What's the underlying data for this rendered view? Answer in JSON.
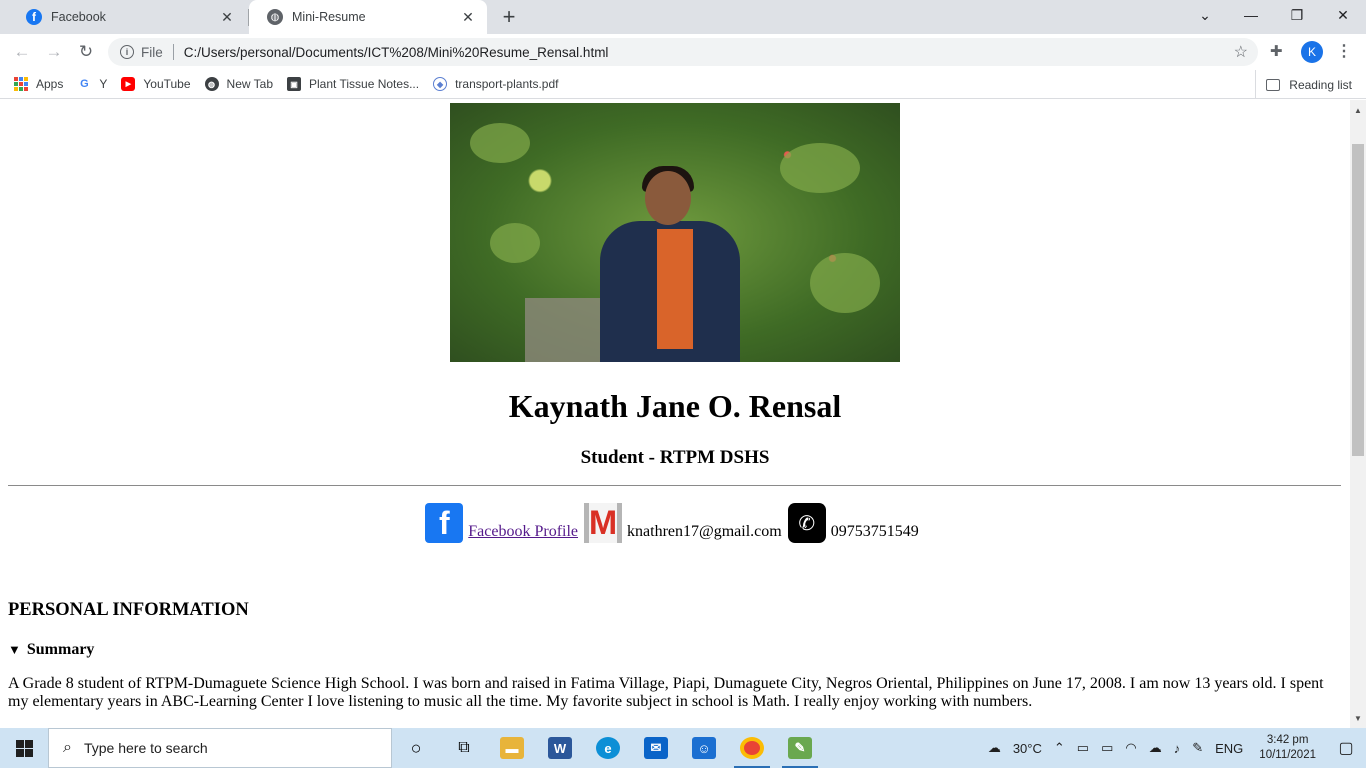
{
  "browser": {
    "tabs": [
      {
        "title": "Facebook",
        "icon": "facebook-icon",
        "active": false
      },
      {
        "title": "Mini-Resume",
        "icon": "globe-icon",
        "active": true
      }
    ],
    "address": {
      "scheme_label": "File",
      "url": "C:/Users/personal/Documents/ICT%208/Mini%20Resume_Rensal.html"
    },
    "profile_initial": "K",
    "bookmarks": [
      {
        "label": "Apps",
        "icon": "apps-grid-icon"
      },
      {
        "label": "Y",
        "icon": "google-icon"
      },
      {
        "label": "YouTube",
        "icon": "youtube-icon"
      },
      {
        "label": "New Tab",
        "icon": "new-tab-icon"
      },
      {
        "label": "Plant Tissue Notes...",
        "icon": "bookmark-page-icon"
      },
      {
        "label": "transport-plants.pdf",
        "icon": "pdf-icon"
      }
    ],
    "reading_list_label": "Reading list"
  },
  "resume": {
    "name": "Kaynath Jane O. Rensal",
    "role": "Student - RTPM DSHS",
    "contacts": {
      "facebook_label": "Facebook Profile",
      "email": "knathren17@gmail.com",
      "phone": "09753751549"
    },
    "section_title": "PERSONAL INFORMATION",
    "summary_label": "Summary",
    "summary_text": "A Grade 8 student of RTPM-Dumaguete Science High School. I was born and raised in Fatima Village, Piapi, Dumaguete City, Negros Oriental, Philippines on June 17, 2008. I am now 13 years old. I spent my elementary years in ABC-Learning Center I love listening to music all the time. My favorite subject in school is Math. I really enjoy working with numbers."
  },
  "taskbar": {
    "search_placeholder": "Type here to search",
    "weather": "30°C",
    "language": "ENG",
    "time": "3:42 pm",
    "date": "10/11/2021"
  },
  "colors": {
    "facebook_blue": "#1877f2",
    "link_visited": "#551a8b",
    "taskbar_bg": "#cfe3f3"
  }
}
